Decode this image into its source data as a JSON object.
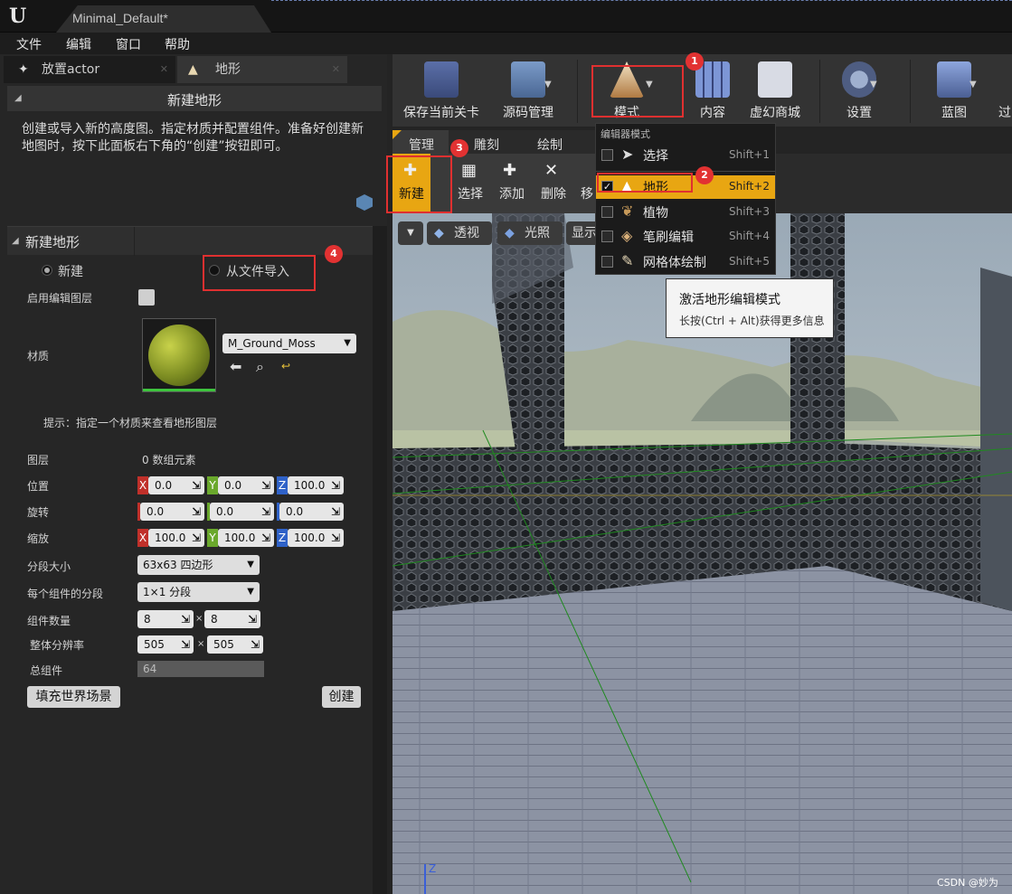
{
  "window": {
    "tab_title": "Minimal_Default*"
  },
  "menubar": [
    "文件",
    "编辑",
    "窗口",
    "帮助"
  ],
  "panel_tabs": {
    "place_actor": "放置actor",
    "landscape": "地形"
  },
  "new_landscape_section": {
    "title": "新建地形",
    "description": "创建或导入新的高度图。指定材质并配置组件。准备好创建新地图时，按下此面板右下角的“创建”按钮即可。"
  },
  "new_landscape_form": {
    "section_title": "新建地形",
    "radio_new": "新建",
    "radio_import": "从文件导入",
    "enable_edit_layers_label": "启用编辑图层",
    "material_label": "材质",
    "material_value": "M_Ground_Moss",
    "hint": "提示：指定一个材质来查看地形图层",
    "layers_label": "图层",
    "layers_value": "0 数组元素",
    "location_label": "位置",
    "location": {
      "x": "0.0",
      "y": "0.0",
      "z": "100.0"
    },
    "rotation_label": "旋转",
    "rotation": {
      "x": "0.0",
      "y": "0.0",
      "z": "0.0"
    },
    "scale_label": "缩放",
    "scale": {
      "x": "100.0",
      "y": "100.0",
      "z": "100.0"
    },
    "section_size_label": "分段大小",
    "section_size_value": "63x63 四边形",
    "sections_per_component_label": "每个组件的分段",
    "sections_per_component_value": "1×1 分段",
    "component_count_label": "组件数量",
    "component_count": {
      "x": "8",
      "y": "8"
    },
    "overall_resolution_label": "整体分辨率",
    "overall_resolution": {
      "x": "505",
      "y": "505"
    },
    "total_components_label": "总组件",
    "total_components_value": "64",
    "fill_world_button": "填充世界场景",
    "create_button": "创建",
    "times_sign": "×"
  },
  "toolbar": {
    "save": "保存当前关卡",
    "source_control": "源码管理",
    "modes": "模式",
    "content": "内容",
    "marketplace": "虚幻商城",
    "settings": "设置",
    "blueprints": "蓝图",
    "overflow": "过"
  },
  "mode_tabs": [
    "管理",
    "雕刻",
    "绘制"
  ],
  "landscape_tools": {
    "new": "新建",
    "select": "选择",
    "add": "添加",
    "delete": "删除",
    "move": "移"
  },
  "viewport": {
    "perspective": "透视",
    "lighting": "光照",
    "show": "显示",
    "axis_z": "Z",
    "watermark": "CSDN @妙为"
  },
  "mode_menu": {
    "header": "编辑器模式",
    "items": [
      {
        "label": "选择",
        "shortcut": "Shift+1",
        "checked": false
      },
      {
        "label": "地形",
        "shortcut": "Shift+2",
        "checked": true
      },
      {
        "label": "植物",
        "shortcut": "Shift+3",
        "checked": false
      },
      {
        "label": "笔刷编辑",
        "shortcut": "Shift+4",
        "checked": false
      },
      {
        "label": "网格体绘制",
        "shortcut": "Shift+5",
        "checked": false
      }
    ]
  },
  "tooltip": {
    "title": "激活地形编辑模式",
    "body": "长按(Ctrl + Alt)获得更多信息"
  },
  "badges": [
    "1",
    "2",
    "3",
    "4"
  ],
  "colors": {
    "highlight": "#e8a612",
    "annotation": "#e03030",
    "axis_x": "#c0302a",
    "axis_y": "#6aa82c",
    "axis_z": "#2f62c8"
  }
}
